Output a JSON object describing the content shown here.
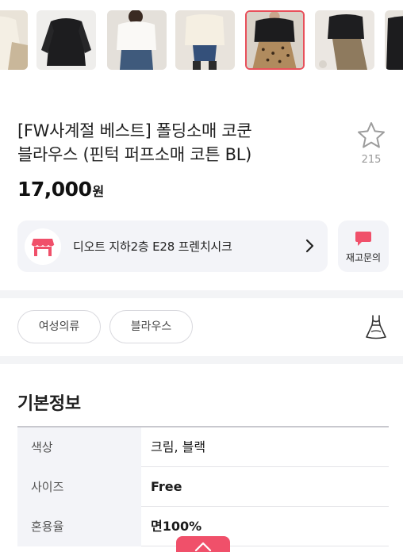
{
  "gallery": {
    "thumbnails": [
      {
        "icon": "thumb-cream-blouse-icon"
      },
      {
        "icon": "thumb-black-blouse-icon"
      },
      {
        "icon": "thumb-white-blouse-jeans-icon"
      },
      {
        "icon": "thumb-cream-blouse-jeans-icon"
      },
      {
        "icon": "thumb-black-blouse-leopard-skirt-icon"
      },
      {
        "icon": "thumb-black-blouse-floral-skirt-icon"
      },
      {
        "icon": "thumb-black-blouse-partial-icon"
      }
    ],
    "selected_index": 4,
    "accent_color": "#e8505b"
  },
  "product": {
    "title_line1": "[FW사계절 베스트] 폴딩소매 코쿤",
    "title_line2": "블라우스 (핀턱 퍼프소매 코튼 BL)",
    "price": "17,000",
    "currency": "원",
    "wishlist_count": "215"
  },
  "store": {
    "name": "디오트 지하2층 E28 프렌치시크",
    "icon": "store-icon",
    "inquiry_label": "재고문의",
    "inquiry_icon": "chat-bubble-icon",
    "brand_color": "#f0506a"
  },
  "tags": [
    {
      "label": "여성의류"
    },
    {
      "label": "블라우스"
    }
  ],
  "basic_info": {
    "section_title": "기본정보",
    "rows": [
      {
        "key": "색상",
        "value": "크림, 블랙"
      },
      {
        "key": "사이즈",
        "value": "Free"
      },
      {
        "key": "혼용율",
        "value": "면100%"
      }
    ]
  }
}
